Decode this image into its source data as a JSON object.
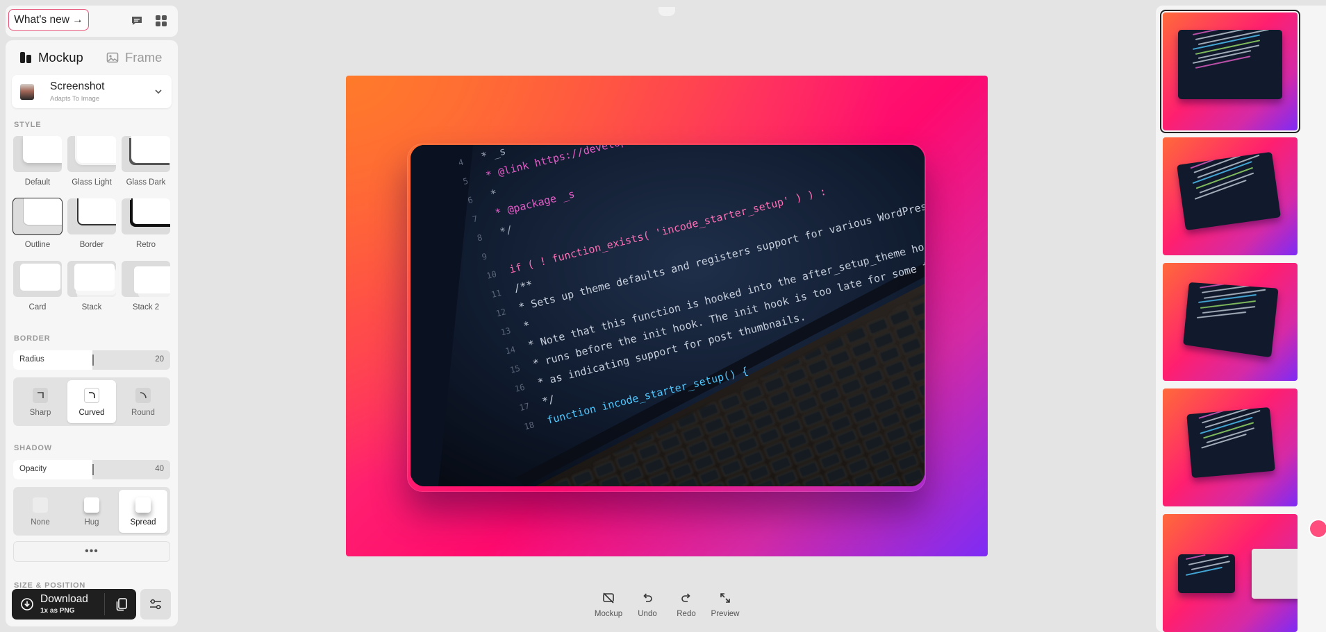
{
  "header": {
    "whats_new_label": "What's new →"
  },
  "tabs": [
    {
      "label": "Mockup",
      "active": true
    },
    {
      "label": "Frame",
      "active": false
    }
  ],
  "device": {
    "name": "Screenshot",
    "subtitle": "Adapts To Image"
  },
  "style_section": {
    "label": "STYLE",
    "styles": [
      {
        "name": "Default",
        "selected": false
      },
      {
        "name": "Glass Light",
        "selected": false
      },
      {
        "name": "Glass Dark",
        "selected": false
      },
      {
        "name": "Outline",
        "selected": true
      },
      {
        "name": "Border",
        "selected": false
      },
      {
        "name": "Retro",
        "selected": false
      },
      {
        "name": "Card",
        "selected": false
      },
      {
        "name": "Stack",
        "selected": false
      },
      {
        "name": "Stack 2",
        "selected": false
      }
    ]
  },
  "border_section": {
    "label": "BORDER",
    "radius": {
      "label": "Radius",
      "value": "20",
      "fraction": 0.42
    },
    "options": [
      {
        "label": "Sharp",
        "active": false
      },
      {
        "label": "Curved",
        "active": true
      },
      {
        "label": "Round",
        "active": false
      }
    ]
  },
  "shadow_section": {
    "label": "SHADOW",
    "opacity": {
      "label": "Opacity",
      "value": "40",
      "fraction": 0.42
    },
    "options": [
      {
        "label": "None",
        "active": false
      },
      {
        "label": "Hug",
        "active": false
      },
      {
        "label": "Spread",
        "active": true
      }
    ],
    "more_label": "•••"
  },
  "size_section": {
    "label": "SIZE & POSITION"
  },
  "download": {
    "label": "Download",
    "sublabel": "1x as PNG"
  },
  "canvas": {
    "gradient_colors": [
      "#ff6a3a",
      "#ff1f6f",
      "#d52aa6",
      "#7e2bf5"
    ],
    "code_lines": [
      {
        "num": "4",
        "text": " * _s",
        "color": "#9aa4b5"
      },
      {
        "num": "5",
        "text": " * @link https://developer.wordpress.org/themes/basics/theme-functions/",
        "color": "#e45cc7"
      },
      {
        "num": "6",
        "text": " *",
        "color": "#9aa4b5"
      },
      {
        "num": "7",
        "text": " * @package _s",
        "color": "#e45cc7"
      },
      {
        "num": "8",
        "text": " */",
        "color": "#9aa4b5"
      },
      {
        "num": "9",
        "text": "",
        "color": "#9aa4b5"
      },
      {
        "num": "10",
        "text": "if ( ! function_exists( 'incode_starter_setup' ) ) :",
        "color": "#ff6fb5"
      },
      {
        "num": "11",
        "text": "  /**",
        "color": "#c7cfdc"
      },
      {
        "num": "12",
        "text": "   * Sets up theme defaults and registers support for various WordPress features.",
        "color": "#c7cfdc"
      },
      {
        "num": "13",
        "text": "   *",
        "color": "#c7cfdc"
      },
      {
        "num": "14",
        "text": "   * Note that this function is hooked into the after_setup_theme hook, which",
        "color": "#c7cfdc"
      },
      {
        "num": "15",
        "text": "   * runs before the init hook. The init hook is too late for some features, such",
        "color": "#c7cfdc"
      },
      {
        "num": "16",
        "text": "   * as indicating support for post thumbnails.",
        "color": "#c7cfdc"
      },
      {
        "num": "17",
        "text": "   */",
        "color": "#c7cfdc"
      },
      {
        "num": "18",
        "text": "  function incode_starter_setup() {",
        "color": "#4fc8ff"
      }
    ]
  },
  "toolbar": [
    {
      "label": "Mockup",
      "icon": "mockup-off-icon"
    },
    {
      "label": "Undo",
      "icon": "undo-icon"
    },
    {
      "label": "Redo",
      "icon": "redo-icon"
    },
    {
      "label": "Preview",
      "icon": "expand-icon"
    }
  ],
  "rail": {
    "thumbnails": [
      {
        "name": "flat",
        "selected": true
      },
      {
        "name": "tilt-left",
        "selected": false
      },
      {
        "name": "tilt-right",
        "selected": false
      },
      {
        "name": "tilt-small",
        "selected": false
      },
      {
        "name": "split",
        "selected": false
      }
    ]
  }
}
